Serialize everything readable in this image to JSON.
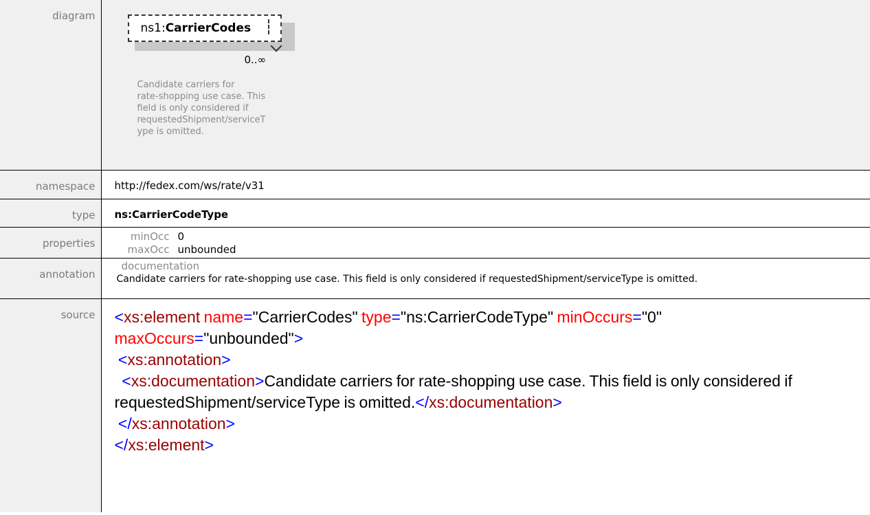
{
  "labels": {
    "diagram": "diagram",
    "namespace": "namespace",
    "type": "type",
    "properties": "properties",
    "annotation": "annotation",
    "source": "source"
  },
  "diagram": {
    "prefix": "ns1:",
    "name": "CarrierCodes",
    "occurrence": "0..∞",
    "documentation": "Candidate carriers for\nrate-shopping use case. This\nfield is only considered if\nrequestedShipment/serviceT\nype is omitted."
  },
  "namespace": "http://fedex.com/ws/rate/v31",
  "type": "ns:CarrierCodeType",
  "properties": [
    {
      "key": "minOcc",
      "value": "0"
    },
    {
      "key": "maxOcc",
      "value": "unbounded"
    }
  ],
  "annotation": {
    "heading": "documentation",
    "text": "Candidate carriers for rate-shopping use case. This field is only considered if requestedShipment/serviceType is omitted."
  },
  "source": {
    "lt": "<",
    "gt": ">",
    "lt_slash": "</",
    "eq": "=",
    "quote": "\"",
    "element_tag": "xs:element",
    "attr_name": "name",
    "attr_name_val": "CarrierCodes",
    "attr_type": "type",
    "attr_type_val": "ns:CarrierCodeType",
    "attr_min": "minOccurs",
    "attr_min_val": "0",
    "attr_max": "maxOccurs",
    "attr_max_val": "unbounded",
    "annotation_tag": "xs:annotation",
    "documentation_tag": "xs:documentation",
    "documentation_text": "Candidate carriers for rate-shopping use case. This field is only considered if requestedShipment/serviceType is omitted."
  }
}
